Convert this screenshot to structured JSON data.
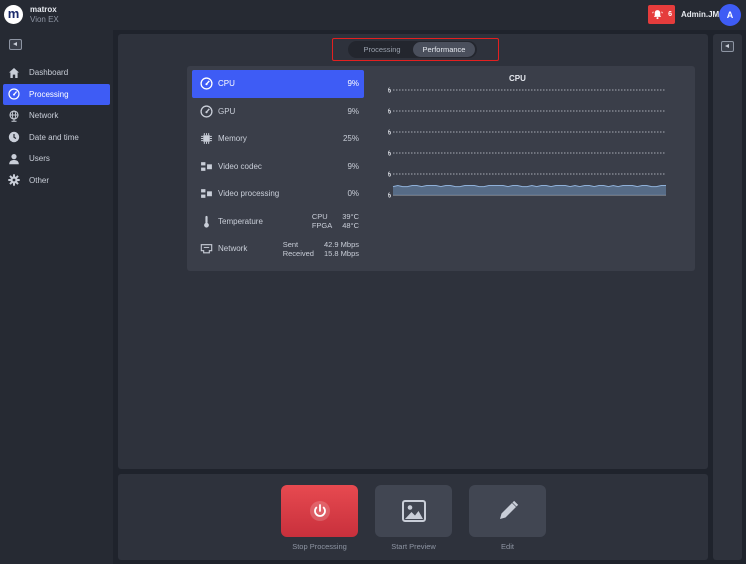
{
  "app": {
    "brand": "matrox",
    "product": "Vion EX",
    "alert_count": "6",
    "user": "Admin.JM",
    "avatar_letter": "A"
  },
  "sidebar": {
    "items": [
      {
        "label": "Dashboard",
        "icon": "home-icon"
      },
      {
        "label": "Processing",
        "icon": "gauge-icon",
        "active": true
      },
      {
        "label": "Network",
        "icon": "globe-icon"
      },
      {
        "label": "Date and time",
        "icon": "clock-icon"
      },
      {
        "label": "Users",
        "icon": "user-icon"
      },
      {
        "label": "Other",
        "icon": "gear-icon"
      }
    ]
  },
  "tabs": [
    {
      "label": "Processing"
    },
    {
      "label": "Performance",
      "active": true
    }
  ],
  "metrics": {
    "cpu": {
      "label": "CPU",
      "value": "9%"
    },
    "gpu": {
      "label": "GPU",
      "value": "9%"
    },
    "memory": {
      "label": "Memory",
      "value": "25%"
    },
    "video_codec": {
      "label": "Video codec",
      "value": "9%"
    },
    "video_processing": {
      "label": "Video processing",
      "value": "0%"
    },
    "temperature": {
      "label": "Temperature",
      "cpu_label": "CPU",
      "cpu_value": "39°C",
      "fpga_label": "FPGA",
      "fpga_value": "48°C"
    },
    "network": {
      "label": "Network",
      "sent_label": "Sent",
      "sent_value": "42.9 Mbps",
      "received_label": "Received",
      "received_value": "15.8 Mbps"
    }
  },
  "chart_data": {
    "type": "area",
    "title": "CPU",
    "yticks": [
      "100%",
      "80%",
      "60%",
      "40%",
      "20%",
      "0%"
    ],
    "ylim": [
      0,
      100
    ],
    "grid": true,
    "values": [
      8,
      9,
      8,
      8,
      9,
      9,
      8,
      9,
      9,
      9,
      8,
      9,
      9,
      8,
      8,
      9,
      9,
      9,
      8,
      8,
      9,
      9,
      9,
      9,
      8,
      9,
      9,
      8,
      8,
      9,
      8,
      9,
      9,
      8,
      9,
      9,
      9,
      8,
      9,
      8,
      9,
      9,
      8,
      9,
      9,
      8,
      9,
      8,
      9,
      9,
      9,
      8,
      9,
      9,
      8,
      8,
      9,
      9
    ],
    "colors": {
      "fill": "#5c7391",
      "line": "#8fb0d8",
      "grid": "#c9ced8"
    }
  },
  "actions": {
    "stop": {
      "label": "Stop Processing",
      "icon": "power-icon"
    },
    "preview": {
      "label": "Start Preview",
      "icon": "image-icon"
    },
    "edit": {
      "label": "Edit",
      "icon": "pencil-icon"
    }
  },
  "colors": {
    "accent": "#3e5cf5",
    "alert": "#e53c3c",
    "stop": "#d93a44"
  }
}
